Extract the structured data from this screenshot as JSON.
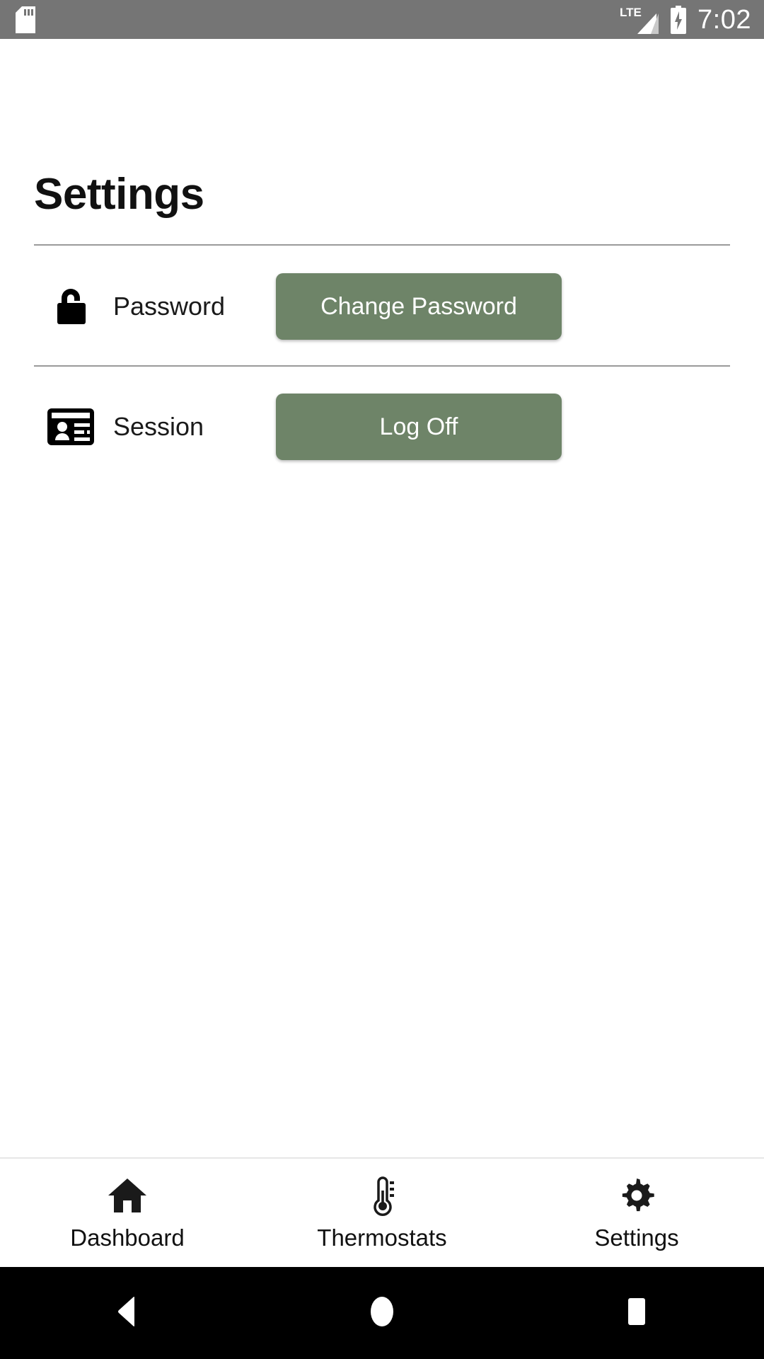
{
  "statusbar": {
    "sdcard_icon": "sdcard-icon",
    "network_label": "LTE",
    "signal_icon": "signal-bars-icon",
    "battery_icon": "battery-charging-icon",
    "time": "7:02"
  },
  "header": {
    "title": "Settings"
  },
  "settings_rows": [
    {
      "icon": "unlock-icon",
      "label": "Password",
      "button_label": "Change Password"
    },
    {
      "icon": "id-card-icon",
      "label": "Session",
      "button_label": "Log Off"
    }
  ],
  "tabbar": {
    "tabs": [
      {
        "icon": "home-icon",
        "label": "Dashboard",
        "active": false
      },
      {
        "icon": "thermometer-icon",
        "label": "Thermostats",
        "active": false
      },
      {
        "icon": "gear-icon",
        "label": "Settings",
        "active": true
      }
    ]
  },
  "system_nav": {
    "back": "back-triangle-icon",
    "home": "home-circle-icon",
    "recents": "recents-square-icon"
  },
  "colors": {
    "statusbar_bg": "#757575",
    "button_green": "#6e8468",
    "page_bg": "#ffffff",
    "divider": "#9a9a9a",
    "sysnav_bg": "#000000"
  }
}
